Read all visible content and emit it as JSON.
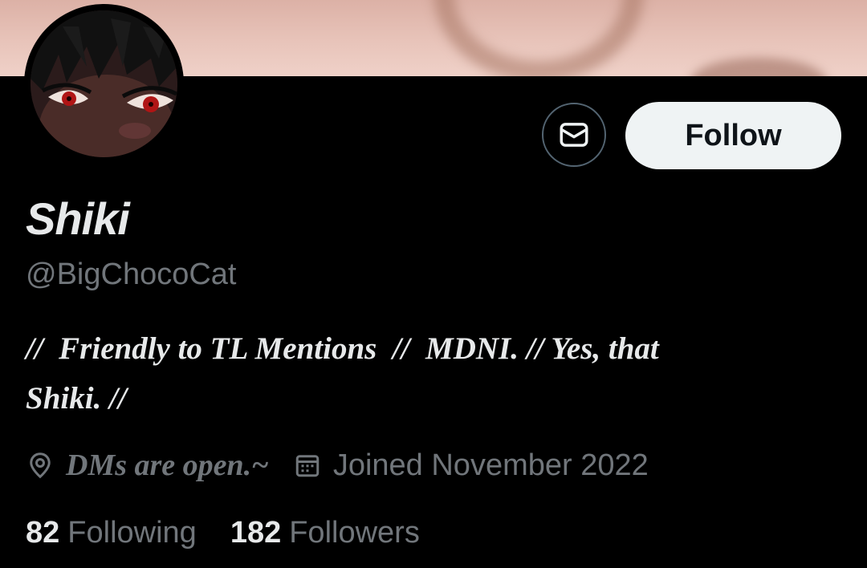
{
  "profile": {
    "display_name": "Shiki",
    "handle": "@BigChocoCat",
    "bio_line1": "//  Friendly to TL Mentions  //  MDNI. // Yes, that",
    "bio_line2": "Shiki. //",
    "location": "DMs are open.~",
    "joined": "Joined November 2022"
  },
  "actions": {
    "follow_label": "Follow",
    "message_icon": "envelope-icon"
  },
  "stats": {
    "following_count": "82",
    "following_label": "Following",
    "followers_count": "182",
    "followers_label": "Followers"
  },
  "icons": {
    "location": "map-pin-icon",
    "joined": "calendar-icon"
  },
  "colors": {
    "background": "#000000",
    "primary_text": "#e7e9ea",
    "secondary_text": "#71767b",
    "button_border": "#536471",
    "follow_bg": "#eff3f4",
    "follow_text": "#0f1419"
  }
}
